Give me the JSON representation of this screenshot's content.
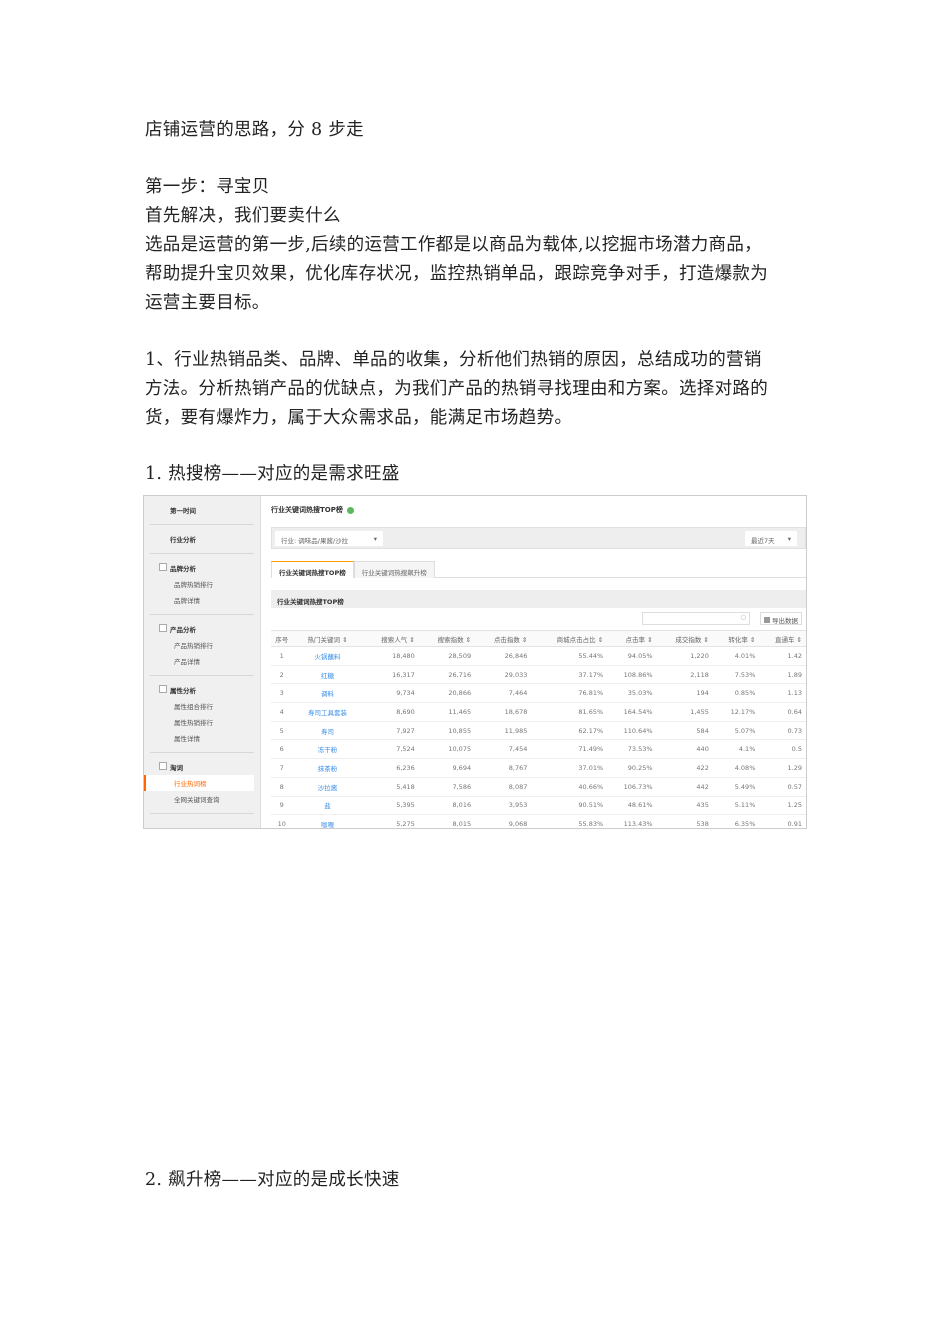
{
  "doc": {
    "heading": "店铺运营的思路，分 8 步走",
    "step1": "第一步：寻宝贝",
    "lead": "首先解决，我们要卖什么",
    "para1": [
      "选品是运营的第一步,后续的运营工作都是以商品为载体,以挖掘市场潜力商品，",
      "帮助提升宝贝效果，优化库存状况，监控热销单品，跟踪竞争对手，打造爆款为",
      "运营主要目标。"
    ],
    "para2": [
      "1、行业热销品类、品牌、单品的收集，分析他们热销的原因，总结成功的营销",
      "方法。分析热销产品的优缺点，为我们产品的热销寻找理由和方案。选择对路的",
      "货，要有爆炸力，属于大众需求品，能满足市场趋势。"
    ],
    "sub1": "1. 热搜榜——对应的是需求旺盛",
    "sub2": "2. 飙升榜——对应的是成长快速"
  },
  "shot": {
    "sidebar": {
      "top": "第一时间",
      "industry": "行业分析",
      "groups": [
        {
          "title": "品牌分析",
          "items": [
            "品牌热销排行",
            "品牌详情"
          ]
        },
        {
          "title": "产品分析",
          "items": [
            "产品热销排行",
            "产品详情"
          ]
        },
        {
          "title": "属性分析",
          "items": [
            "属性组合排行",
            "属性热销排行",
            "属性详情"
          ]
        },
        {
          "title": "淘词",
          "items": [
            "行业热词榜",
            "全网关键词查询"
          ]
        }
      ]
    },
    "title": "行业关键词热搜TOP榜",
    "industry_select": "行业: 调味品/果酱/沙拉",
    "period_select": "最近7天",
    "tabs": [
      "行业关键词热搜TOP榜",
      "行业关键词热搜飙升榜"
    ],
    "section": "行业关键词热搜TOP榜",
    "export": "导出数据",
    "columns": [
      "序号",
      "热门关键词 ⇕",
      "搜索人气 ⇕",
      "搜索指数 ⇕",
      "点击指数 ⇕",
      "商城点击占比 ⇕",
      "点击率 ⇕",
      "成交指数 ⇕",
      "转化率 ⇕",
      "直通车 ⇕"
    ],
    "rows": [
      [
        "1",
        "火锅蘸料",
        "18,480",
        "28,509",
        "26,846",
        "55.44%",
        "94.05%",
        "1,220",
        "4.01%",
        "1.42"
      ],
      [
        "2",
        "红糖",
        "16,317",
        "26,716",
        "29,033",
        "37.17%",
        "108.86%",
        "2,118",
        "7.53%",
        "1.89"
      ],
      [
        "3",
        "调料",
        "9,734",
        "20,866",
        "7,464",
        "76.81%",
        "35.03%",
        "194",
        "0.85%",
        "1.13"
      ],
      [
        "4",
        "寿司工具套装",
        "8,690",
        "11,465",
        "18,678",
        "81.65%",
        "164.54%",
        "1,455",
        "12.17%",
        "0.64"
      ],
      [
        "5",
        "寿司",
        "7,927",
        "10,855",
        "11,985",
        "62.17%",
        "110.64%",
        "584",
        "5.07%",
        "0.73"
      ],
      [
        "6",
        "冻干粉",
        "7,524",
        "10,075",
        "7,454",
        "71.49%",
        "73.53%",
        "440",
        "4.1%",
        "0.5"
      ],
      [
        "7",
        "抹茶粉",
        "6,236",
        "9,694",
        "8,767",
        "37.01%",
        "90.25%",
        "422",
        "4.08%",
        "1.29"
      ],
      [
        "8",
        "沙拉酱",
        "5,418",
        "7,586",
        "8,087",
        "40.66%",
        "106.73%",
        "442",
        "5.49%",
        "0.57"
      ],
      [
        "9",
        "盐",
        "5,395",
        "8,016",
        "3,953",
        "90.51%",
        "48.61%",
        "435",
        "5.11%",
        "1.25"
      ],
      [
        "10",
        "咖喱",
        "5,275",
        "8,015",
        "9,068",
        "55.83%",
        "113.43%",
        "538",
        "6.35%",
        "0.91"
      ]
    ]
  }
}
